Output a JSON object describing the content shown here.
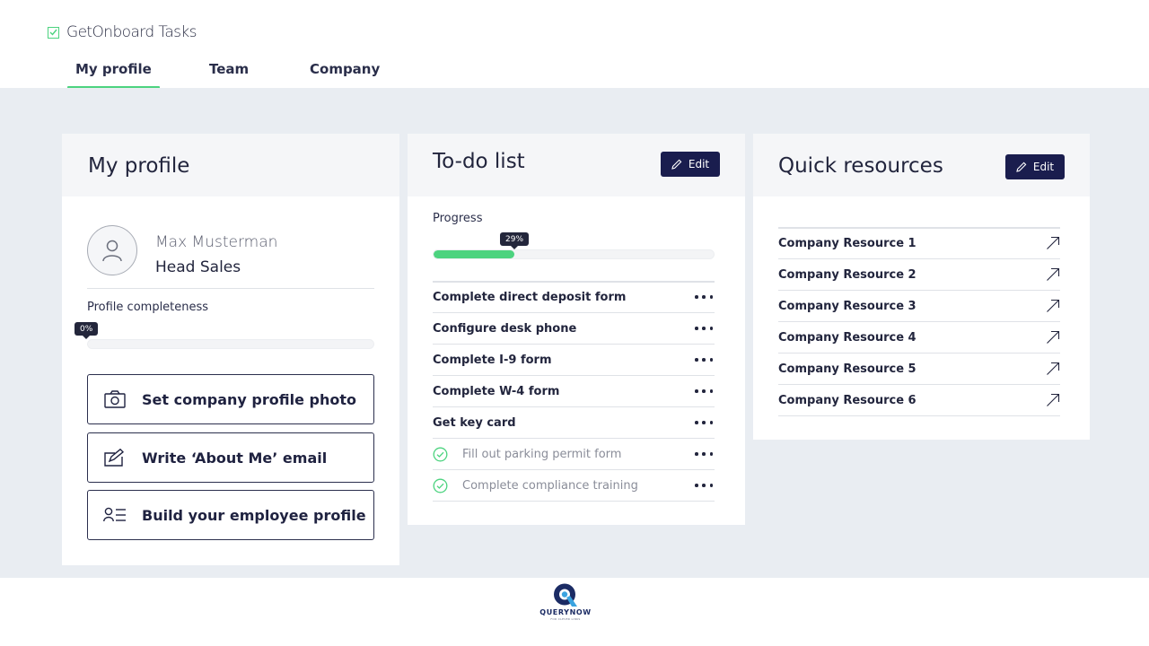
{
  "app": {
    "name": "GetOnboard Tasks"
  },
  "nav": {
    "tabs": [
      {
        "label": "My profile"
      },
      {
        "label": "Team"
      },
      {
        "label": "Company"
      }
    ]
  },
  "profile_card": {
    "title": "My profile",
    "name": "Max Musterman",
    "role": "Head Sales",
    "completeness_label": "Profile completeness",
    "completeness_text": "0%",
    "completeness_value": 0,
    "actions": [
      {
        "label": "Set company profile photo",
        "icon": "camera-icon"
      },
      {
        "label": "Write ‘About Me’ email",
        "icon": "edit-note-icon"
      },
      {
        "label": "Build your employee profile",
        "icon": "profile-list-icon"
      }
    ]
  },
  "todo_card": {
    "title": "To-do list",
    "edit_label": "Edit",
    "progress_label": "Progress",
    "progress_text": "29%",
    "progress_value": 29,
    "items": [
      {
        "label": "Complete direct deposit form",
        "done": false
      },
      {
        "label": "Configure desk phone",
        "done": false
      },
      {
        "label": "Complete I-9 form",
        "done": false
      },
      {
        "label": "Complete W-4 form",
        "done": false
      },
      {
        "label": "Get key card",
        "done": false
      },
      {
        "label": "Fill out parking permit form",
        "done": true
      },
      {
        "label": "Complete compliance training",
        "done": true
      }
    ]
  },
  "resources_card": {
    "title": "Quick resources",
    "edit_label": "Edit",
    "items": [
      {
        "label": "Company Resource 1"
      },
      {
        "label": "Company Resource 2"
      },
      {
        "label": "Company Resource 3"
      },
      {
        "label": "Company Resource 4"
      },
      {
        "label": "Company Resource 5"
      },
      {
        "label": "Company Resource 6"
      }
    ]
  },
  "footer": {
    "logo_text": "QUERYNOW",
    "logo_sub": "FOR CLEVER LINKS"
  },
  "colors": {
    "accent": "#4cd37f",
    "primary_button": "#1a1d4e",
    "background": "#e9edf2"
  }
}
